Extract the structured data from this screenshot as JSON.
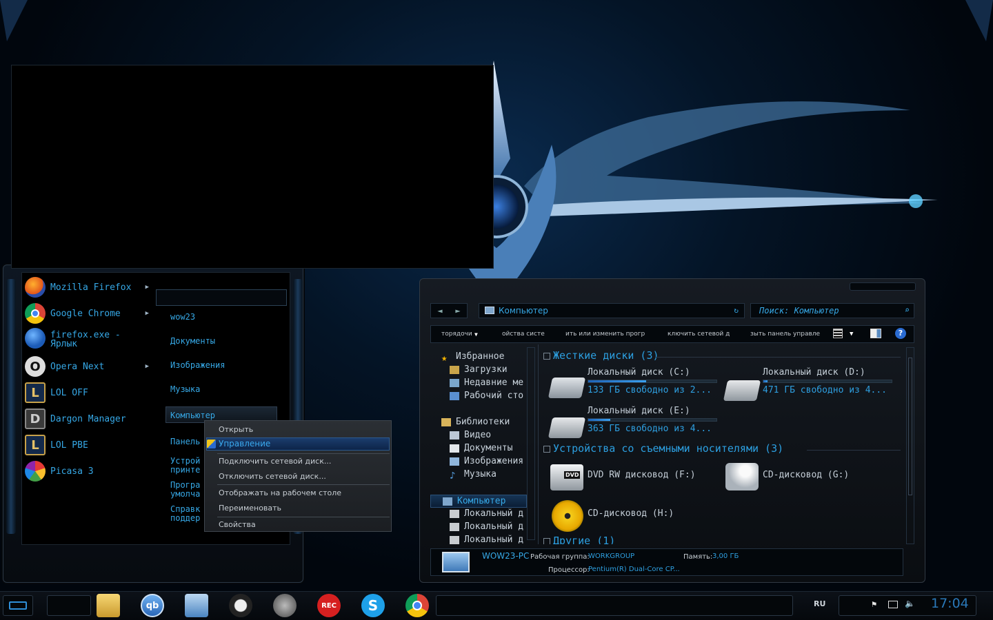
{
  "start_menu": {
    "programs": [
      {
        "label": "Mozilla Firefox",
        "icon": "firefox-icon",
        "has_arrow": true
      },
      {
        "label": "Google Chrome",
        "icon": "chrome-icon",
        "has_arrow": true
      },
      {
        "label": "firefox.exe -",
        "label2": "Ярлык",
        "icon": "firefox-icon",
        "has_arrow": false
      },
      {
        "label": "Opera Next",
        "icon": "opera-icon",
        "has_arrow": true
      },
      {
        "label": "LOL OFF",
        "icon": "league-icon",
        "has_arrow": false
      },
      {
        "label": "Dargon Manager",
        "icon": "dragon-manager-icon",
        "has_arrow": false
      },
      {
        "label": "LOL PBE",
        "icon": "league-icon",
        "has_arrow": false
      },
      {
        "label": "Picasa 3",
        "icon": "picasa-icon",
        "has_arrow": false
      }
    ],
    "places": {
      "user": "wow23",
      "documents": "Документы",
      "pictures": "Изображения",
      "music": "Музыка",
      "computer": "Компьютер",
      "panel": "Панель",
      "devices": "Устрой",
      "devices2": "принте",
      "programs": "Програ",
      "programs2": "умолча",
      "help": "Справк",
      "help2": "поддер"
    }
  },
  "context_menu": {
    "items": [
      "Открыть",
      "Управление",
      "Подключить сетевой диск...",
      "Отключить сетевой диск...",
      "Отображать на рабочем столе",
      "Переименовать",
      "Свойства"
    ],
    "selected": "Управление"
  },
  "explorer": {
    "address": "Компьютер",
    "search_placeholder": "Поиск: Компьютер",
    "toolbar": [
      "торядочи",
      "ойства систе",
      "ить или изменить прогр",
      "ключить сетевой д",
      "зыть панель управле"
    ],
    "nav": {
      "favorites": "Избранное",
      "downloads": "Загрузки",
      "recent": "Недавние ме",
      "desktop": "Рабочий сто",
      "libraries": "Библиотеки",
      "video": "Видео",
      "documents": "Документы",
      "pictures": "Изображения",
      "music": "Музыка",
      "computer": "Компьютер",
      "local1": "Локальный д",
      "local2": "Локальный д",
      "local3": "Локальный д"
    },
    "groups": {
      "hdd": "Жесткие диски (3)",
      "removable": "Устройства со съемными носителями (3)",
      "other": "Другие (1)"
    },
    "drives": [
      {
        "name": "Локальный диск (C:)",
        "free": "133 ГБ свободно из 2...",
        "fill": 0.45
      },
      {
        "name": "Локальный диск (D:)",
        "free": "471 ГБ свободно из 4...",
        "fill": 0.03
      },
      {
        "name": "Локальный диск (E:)",
        "free": "363 ГБ свободно из 4...",
        "fill": 0.17
      }
    ],
    "removable": [
      {
        "name": "DVD RW дисковод (F:)"
      },
      {
        "name": "CD-дисковод (G:)"
      },
      {
        "name": "CD-дисковод (H:)"
      }
    ],
    "details": {
      "pc_name": "WOW23-PC",
      "workgroup_label": "Рабочая группа:",
      "workgroup": "WORKGROUP",
      "memory_label": "Память:",
      "memory": "3,00 ГБ",
      "cpu_label": "Процессор:",
      "cpu": "Pentium(R) Dual-Core CP..."
    }
  },
  "taskbar": {
    "language": "RU",
    "clock": "17:04",
    "rec_label": "REC",
    "qb_label": "qb",
    "pins": [
      "explorer-icon",
      "qbittorrent-icon",
      "remote-desktop-icon",
      "game-icon",
      "steam-icon",
      "recorder-icon",
      "skype-icon",
      "chrome-icon"
    ]
  },
  "colors": {
    "accent": "#2fa5e0",
    "background": "#01050b",
    "selection": "#1b3d6d"
  }
}
